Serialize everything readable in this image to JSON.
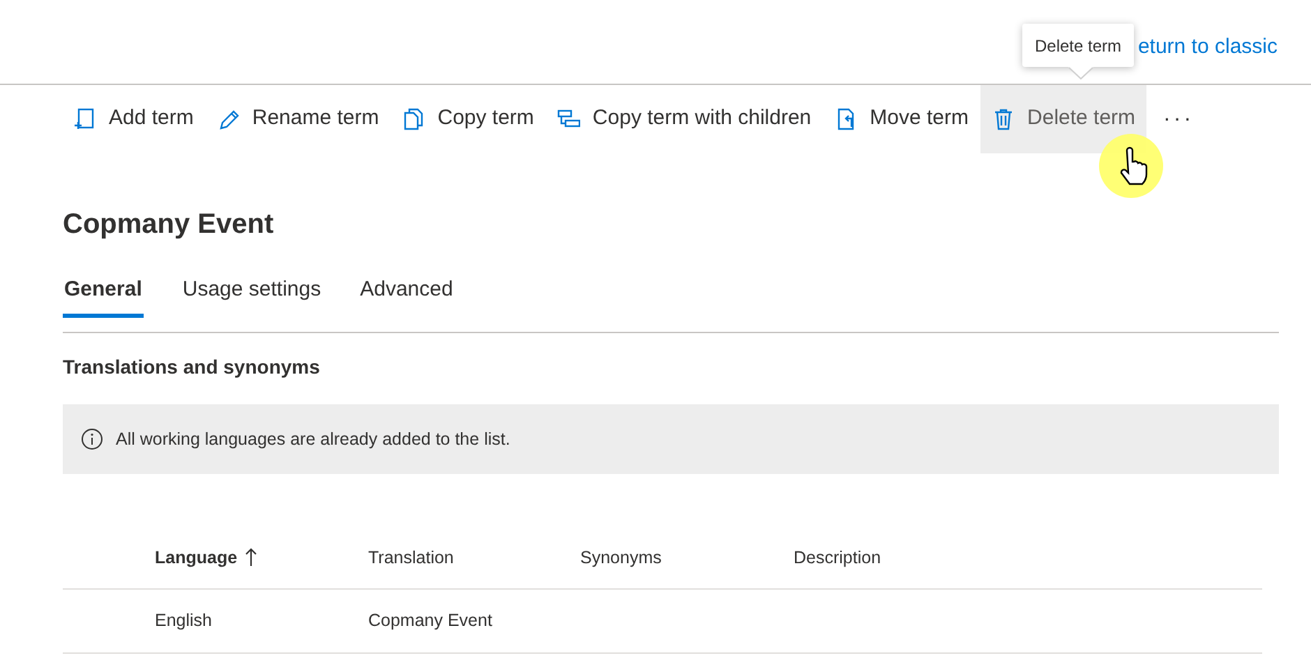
{
  "header": {
    "link": "eturn to classic",
    "tooltip": "Delete term"
  },
  "toolbar": [
    {
      "kind": "add",
      "label": "Add term",
      "hovered": false
    },
    {
      "kind": "rename",
      "label": "Rename term",
      "hovered": false
    },
    {
      "kind": "copy",
      "label": "Copy term",
      "hovered": false
    },
    {
      "kind": "copy-children",
      "label": "Copy term with children",
      "hovered": false
    },
    {
      "kind": "move",
      "label": "Move term",
      "hovered": false
    },
    {
      "kind": "delete",
      "label": "Delete term",
      "hovered": true
    }
  ],
  "more": "···",
  "title": "Copmany Event",
  "tabs": [
    {
      "label": "General",
      "selected": true
    },
    {
      "label": "Usage settings",
      "selected": false
    },
    {
      "label": "Advanced",
      "selected": false
    }
  ],
  "section": "Translations and synonyms",
  "info": "All working languages are already added to the list.",
  "table": {
    "columns": [
      {
        "label": "Language",
        "sorted": true
      },
      {
        "label": "Translation",
        "sorted": false
      },
      {
        "label": "Synonyms",
        "sorted": false
      },
      {
        "label": "Description",
        "sorted": false
      }
    ],
    "rows": [
      [
        "English",
        "Copmany Event"
      ]
    ]
  }
}
